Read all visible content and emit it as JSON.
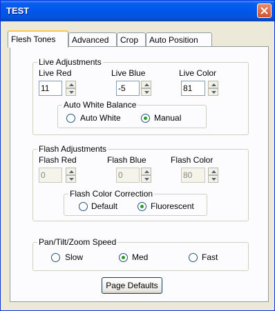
{
  "window": {
    "title": "TEST"
  },
  "tabs": [
    {
      "label": "Flesh Tones",
      "active": true
    },
    {
      "label": "Advanced",
      "active": false
    },
    {
      "label": "Crop",
      "active": false
    },
    {
      "label": "Auto Position",
      "active": false
    }
  ],
  "live": {
    "title": "Live Adjustments",
    "red": {
      "label": "Live Red",
      "value": "11"
    },
    "blue": {
      "label": "Live Blue",
      "value": "-5"
    },
    "color": {
      "label": "Live Color",
      "value": "81"
    },
    "awb": {
      "title": "Auto White Balance",
      "options": [
        {
          "label": "Auto White",
          "selected": false
        },
        {
          "label": "Manual",
          "selected": true
        }
      ]
    }
  },
  "flash": {
    "title": "Flash Adjustments",
    "red": {
      "label": "Flash Red",
      "value": "0"
    },
    "blue": {
      "label": "Flash Blue",
      "value": "0"
    },
    "color": {
      "label": "Flash Color",
      "value": "80"
    },
    "correction": {
      "title": "Flash Color Correction",
      "options": [
        {
          "label": "Default",
          "selected": false
        },
        {
          "label": "Fluorescent",
          "selected": true
        }
      ]
    }
  },
  "ptz": {
    "title": "Pan/Tilt/Zoom Speed",
    "options": [
      {
        "label": "Slow",
        "selected": false
      },
      {
        "label": "Med",
        "selected": true
      },
      {
        "label": "Fast",
        "selected": false
      }
    ]
  },
  "buttons": {
    "page_defaults": "Page Defaults"
  },
  "colors": {
    "titlebar": "#0058ee",
    "panel": "#fcfcfe",
    "window": "#ece9d8",
    "tab_accent": "#ffc83c",
    "radio_dot": "#21a121"
  }
}
